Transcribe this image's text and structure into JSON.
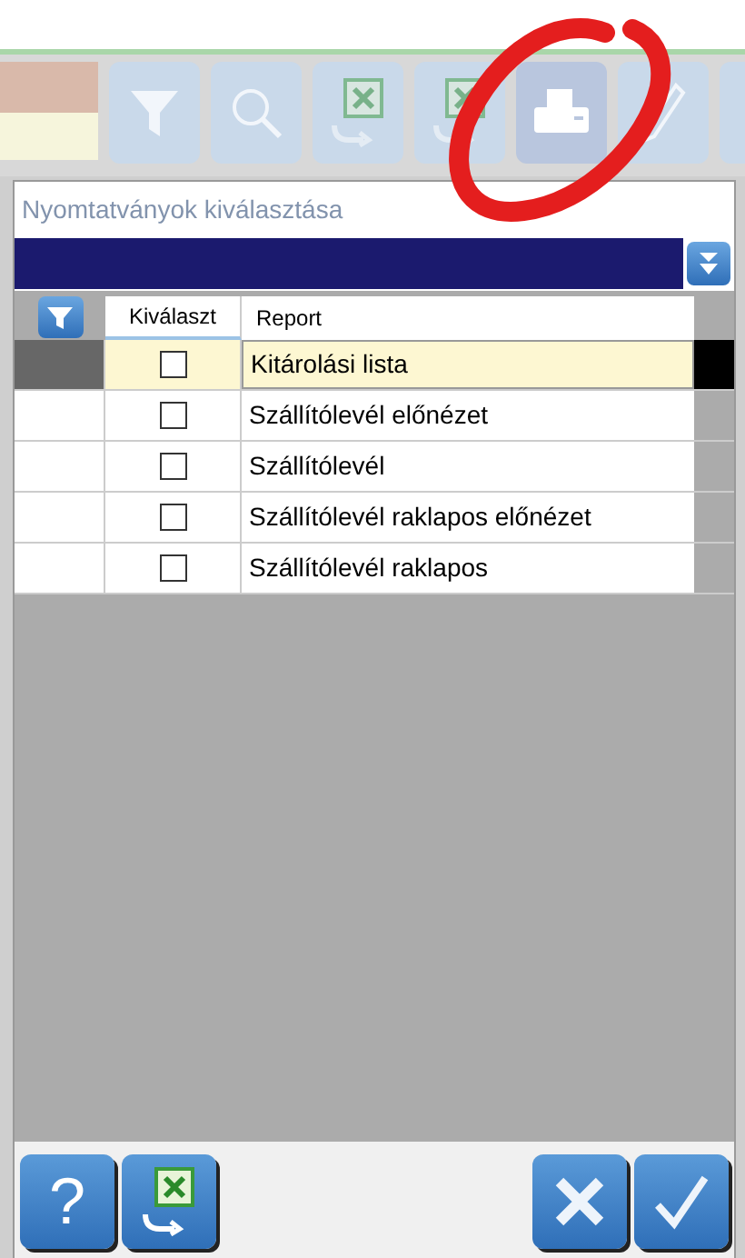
{
  "dialog": {
    "title": "Nyomtatványok kiválasztása",
    "columns": [
      "Kiválaszt",
      "Report"
    ],
    "rows": [
      {
        "report": "Kitárolási lista",
        "checked": false,
        "selected": true
      },
      {
        "report": "Szállítólevél előnézet",
        "checked": false,
        "selected": false
      },
      {
        "report": "Szállítólevél",
        "checked": false,
        "selected": false
      },
      {
        "report": "Szállítólevél raklapos előnézet",
        "checked": false,
        "selected": false
      },
      {
        "report": "Szállítólevél raklapos",
        "checked": false,
        "selected": false
      }
    ],
    "help_button": "?"
  }
}
